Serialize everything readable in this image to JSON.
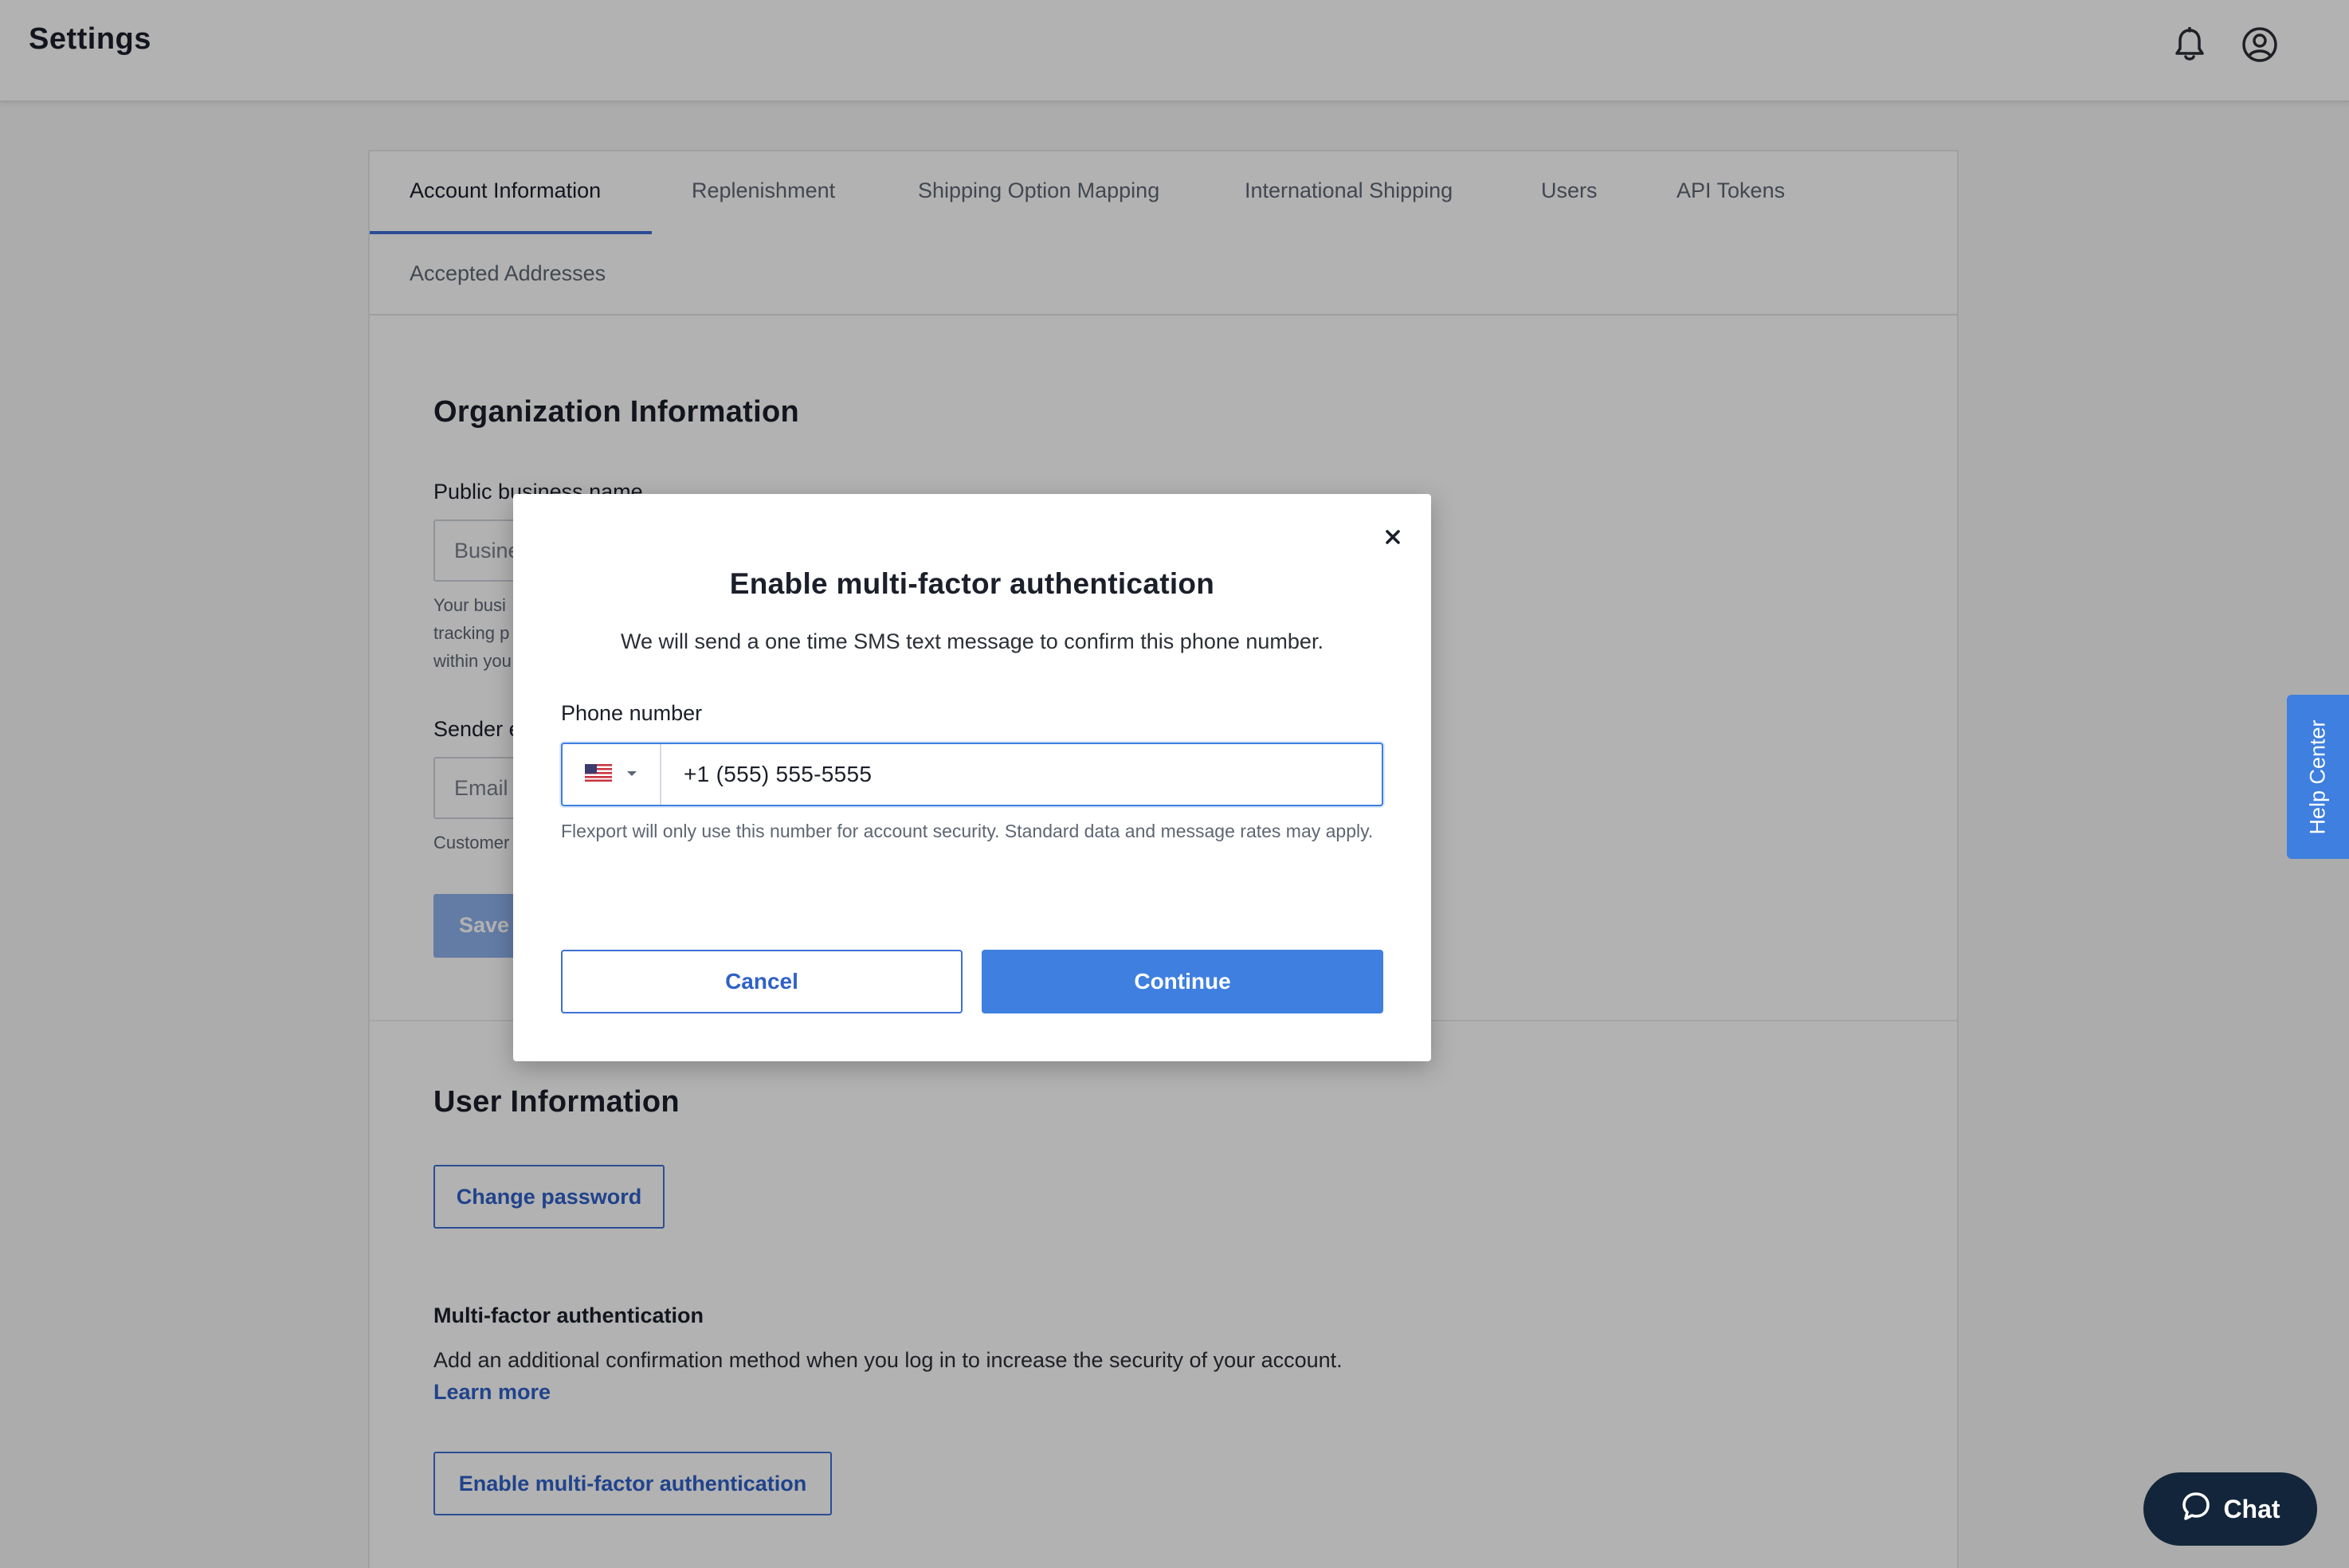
{
  "header": {
    "title": "Settings",
    "bell_icon": "bell-icon",
    "account_icon": "account-circle-icon"
  },
  "tabs": [
    {
      "label": "Account Information",
      "active": true
    },
    {
      "label": "Replenishment"
    },
    {
      "label": "Shipping Option Mapping"
    },
    {
      "label": "International Shipping"
    },
    {
      "label": "Users"
    },
    {
      "label": "API Tokens"
    },
    {
      "label": "Accepted Addresses"
    }
  ],
  "org": {
    "title": "Organization Information",
    "business_name_label": "Public business name",
    "business_name_placeholder": "Busine",
    "business_help_lines": [
      "Your busi",
      "tracking p",
      "within you"
    ],
    "sender_label": "Sender e",
    "sender_placeholder": "Email",
    "sender_help": "Customer",
    "save_label": "Save"
  },
  "user": {
    "title": "User Information",
    "change_password_label": "Change password",
    "mfa_heading": "Multi-factor authentication",
    "mfa_description": "Add an additional confirmation method when you log in to increase the security of your account.",
    "learn_more": "Learn more",
    "enable_mfa_label": "Enable multi-factor authentication"
  },
  "modal": {
    "title": "Enable multi-factor authentication",
    "subtitle": "We will send a one time SMS text message to confirm this phone number.",
    "phone_label": "Phone number",
    "country_flag": "us-flag-icon",
    "phone_value": "+1 (555) 555-5555",
    "help_text": "Flexport will only use this number for account security. Standard data and message rates may apply.",
    "cancel_label": "Cancel",
    "continue_label": "Continue"
  },
  "help_center": {
    "label": "Help Center"
  },
  "chat": {
    "label": "Chat"
  },
  "colors": {
    "primary": "#3e7fe0",
    "link": "#2f61c7",
    "chat_bg": "#12253a"
  }
}
